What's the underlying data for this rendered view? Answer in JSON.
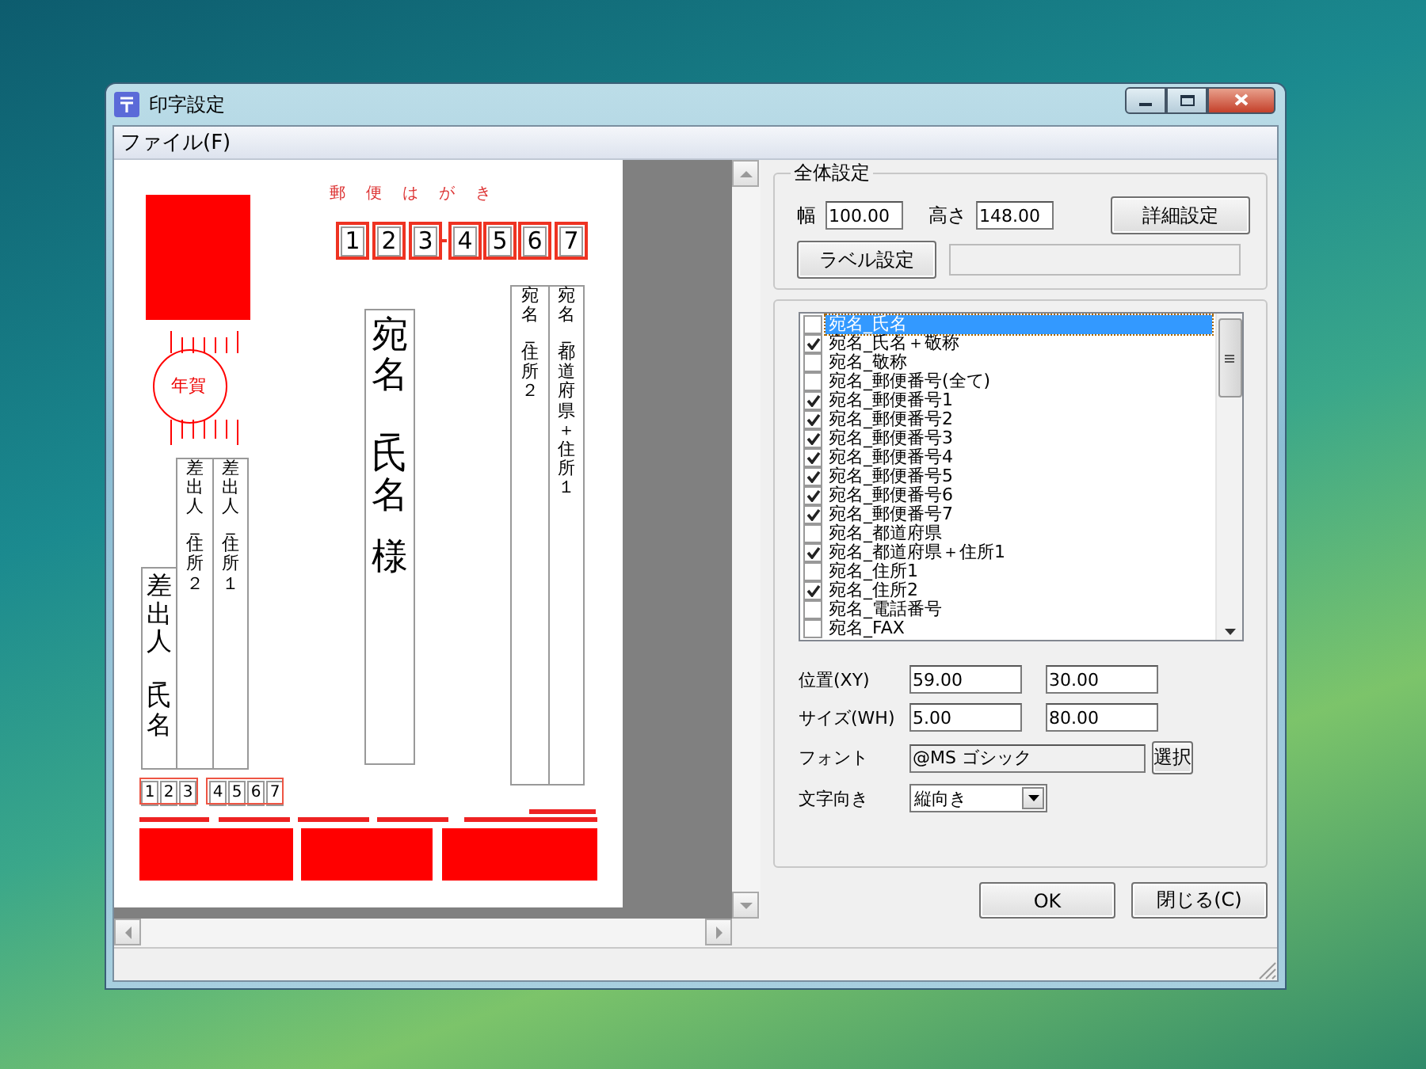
{
  "window": {
    "title": "印字設定"
  },
  "menu": [
    {
      "label": "ファイル(F)"
    }
  ],
  "preview": {
    "postcard_title": "郵便はがき",
    "postal_digits": [
      "1",
      "2",
      "3",
      "4",
      "5",
      "6",
      "7"
    ],
    "new_year_mark": "年賀",
    "recipient_name": "宛名_氏名",
    "honorific": "様",
    "recipient_address_2": "宛名_住所２",
    "recipient_address_1": "宛名_都道府県＋住所１",
    "sender_name": "差出人_氏名",
    "sender_address_2": "差出人_住所２",
    "sender_address_1": "差出人_住所１",
    "sender_postal_digits": [
      "1",
      "2",
      "3",
      "4",
      "5",
      "6",
      "7"
    ]
  },
  "overall_settings": {
    "title": "全体設定",
    "width_label": "幅",
    "width_value": "100.00",
    "height_label": "高さ",
    "height_value": "148.00",
    "detail_button": "詳細設定",
    "label_button": "ラベル設定"
  },
  "field_list": [
    {
      "label": "宛名_氏名",
      "checked": false,
      "selected": true
    },
    {
      "label": "宛名_氏名＋敬称",
      "checked": true,
      "selected": false
    },
    {
      "label": "宛名_敬称",
      "checked": false,
      "selected": false
    },
    {
      "label": "宛名_郵便番号(全て)",
      "checked": false,
      "selected": false
    },
    {
      "label": "宛名_郵便番号1",
      "checked": true,
      "selected": false
    },
    {
      "label": "宛名_郵便番号2",
      "checked": true,
      "selected": false
    },
    {
      "label": "宛名_郵便番号3",
      "checked": true,
      "selected": false
    },
    {
      "label": "宛名_郵便番号4",
      "checked": true,
      "selected": false
    },
    {
      "label": "宛名_郵便番号5",
      "checked": true,
      "selected": false
    },
    {
      "label": "宛名_郵便番号6",
      "checked": true,
      "selected": false
    },
    {
      "label": "宛名_郵便番号7",
      "checked": true,
      "selected": false
    },
    {
      "label": "宛名_都道府県",
      "checked": false,
      "selected": false
    },
    {
      "label": "宛名_都道府県＋住所1",
      "checked": true,
      "selected": false
    },
    {
      "label": "宛名_住所1",
      "checked": false,
      "selected": false
    },
    {
      "label": "宛名_住所2",
      "checked": true,
      "selected": false
    },
    {
      "label": "宛名_電話番号",
      "checked": false,
      "selected": false
    },
    {
      "label": "宛名_FAX",
      "checked": false,
      "selected": false
    }
  ],
  "properties": {
    "position_label": "位置(XY)",
    "x_value": "59.00",
    "y_value": "30.00",
    "size_label": "サイズ(WH)",
    "w_value": "5.00",
    "h_value": "80.00",
    "font_label": "フォント",
    "font_value": "@MS ゴシック",
    "font_button": "選択",
    "direction_label": "文字向き",
    "direction_value": "縦向き"
  },
  "buttons": [
    {
      "label": "OK"
    },
    {
      "label": "閉じる(C)"
    }
  ]
}
